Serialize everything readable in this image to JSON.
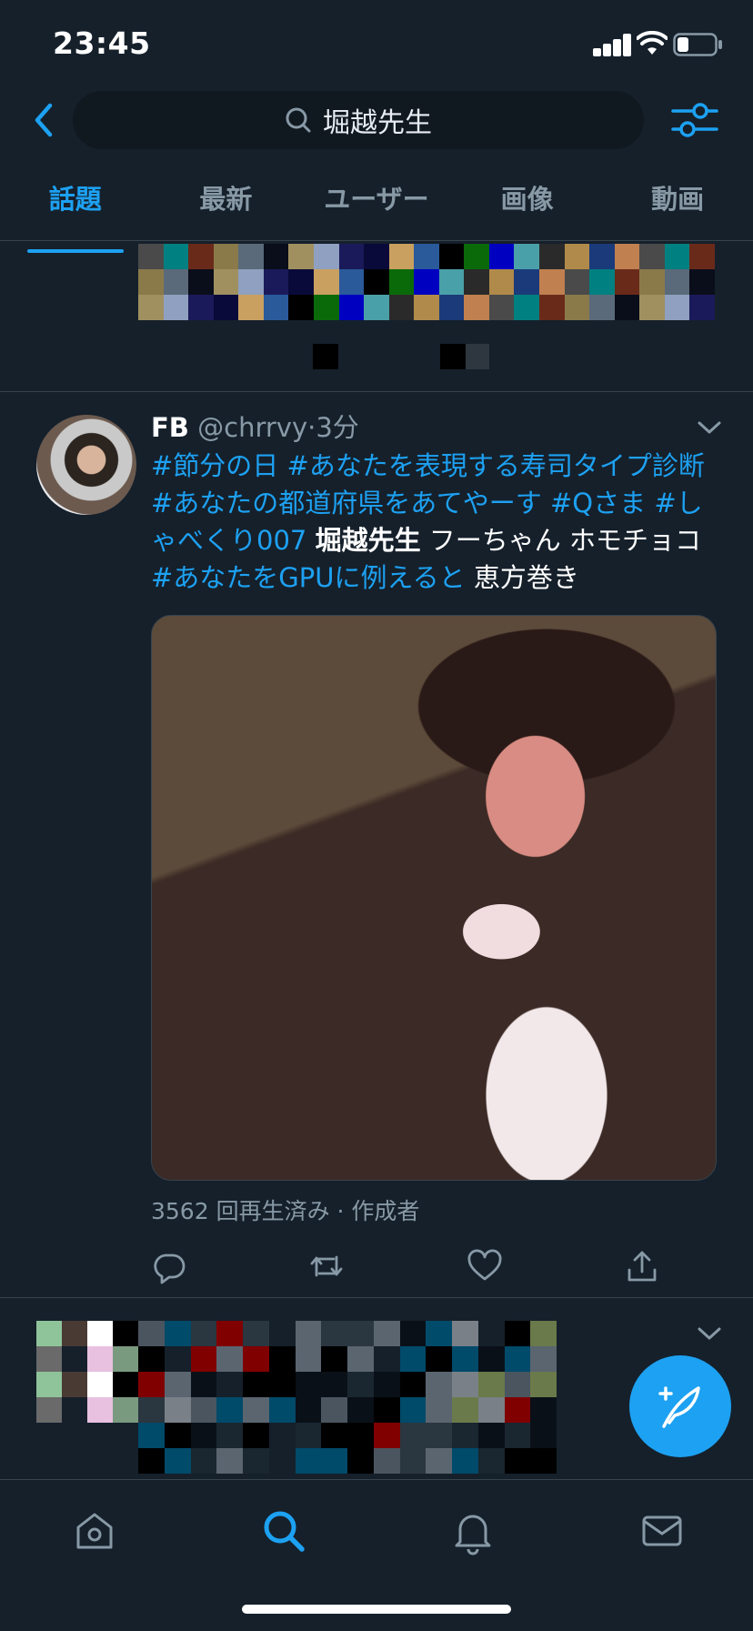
{
  "status": {
    "time": "23:45"
  },
  "search": {
    "query": "堀越先生"
  },
  "tabs": [
    {
      "label": "話題"
    },
    {
      "label": "最新"
    },
    {
      "label": "ユーザー"
    },
    {
      "label": "画像"
    },
    {
      "label": "動画"
    }
  ],
  "active_tab": 0,
  "tweet": {
    "name": "FB",
    "handle": "@chrrvy",
    "separator": "·",
    "time": "3分",
    "text_parts": [
      {
        "text": "#節分の日",
        "type": "hashtag"
      },
      {
        "text": " ",
        "type": "plain"
      },
      {
        "text": "#あなたを表現する寿司タイプ診断",
        "type": "hashtag"
      },
      {
        "text": " ",
        "type": "plain"
      },
      {
        "text": "#あなたの都道府県をあてやーす",
        "type": "hashtag"
      },
      {
        "text": " ",
        "type": "plain"
      },
      {
        "text": "#Qさま",
        "type": "hashtag"
      },
      {
        "text": " ",
        "type": "plain"
      },
      {
        "text": "#しゃべくり007",
        "type": "hashtag"
      },
      {
        "text": " ",
        "type": "plain"
      },
      {
        "text": "堀越先生",
        "type": "bold"
      },
      {
        "text": " フーちゃん ホモチョコ ",
        "type": "plain"
      },
      {
        "text": "#あなたをGPUに例えると",
        "type": "hashtag"
      },
      {
        "text": " 恵方巻き",
        "type": "plain"
      }
    ],
    "media_meta": "3562 回再生済み · 作成者"
  },
  "icons": {
    "back": "chevron-left-icon",
    "search": "search-icon",
    "filter": "filter-sliders-icon",
    "reply": "reply-icon",
    "retweet": "retweet-icon",
    "like": "heart-icon",
    "share": "share-icon",
    "compose": "compose-feather-icon",
    "home": "home-icon",
    "explore": "search-icon",
    "notifications": "bell-icon",
    "messages": "envelope-icon"
  },
  "colors": {
    "background": "#15202b",
    "accent": "#1da1f2",
    "secondary_text": "#8899a6",
    "divider": "#38444d"
  }
}
